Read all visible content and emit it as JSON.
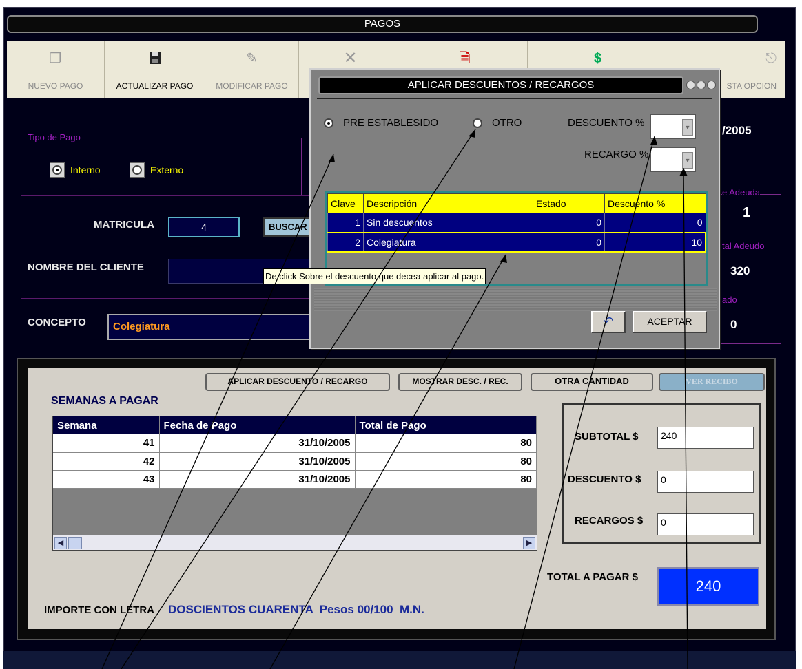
{
  "window": {
    "title": "PAGOS"
  },
  "toolbar": {
    "items": [
      {
        "label": "NUEVO PAGO",
        "icon": "new-page-icon",
        "glyph": "❐"
      },
      {
        "label": "ACTUALIZAR PAGO",
        "icon": "save-icon",
        "glyph": "💾"
      },
      {
        "label": "MODIFICAR PAGO",
        "icon": "edit-icon",
        "glyph": "✎"
      },
      {
        "label": "",
        "icon": "cancel-icon",
        "glyph": "✕"
      },
      {
        "label": "",
        "icon": "report-icon",
        "glyph": "🗎"
      },
      {
        "label": "",
        "icon": "money-icon",
        "glyph": "$"
      },
      {
        "label": "STA OPCION",
        "icon": "exit-door-icon",
        "glyph": "⎋"
      }
    ]
  },
  "tipo_pago": {
    "legend": "Tipo de Pago",
    "interno": "Interno",
    "externo": "Externo",
    "selected": "Interno"
  },
  "cliente": {
    "matricula_label": "MATRICULA",
    "matricula_value": "4",
    "buscar_label": "BUSCAR",
    "nombre_label": "NOMBRE DEL CLIENTE",
    "concepto_label": "CONCEPTO",
    "concepto_value": "Colegiatura"
  },
  "right_info": {
    "date_partial": "/2005",
    "adeuda_label": "e Adeuda",
    "adeuda_value": "1",
    "total_adeudo_label": "tal Adeudo",
    "total_adeudo_value": "320",
    "pagado_label": "ado",
    "pagado_value": "0"
  },
  "dialog": {
    "title": "APLICAR DESCUENTOS / RECARGOS",
    "option_pre": "PRE ESTABLESIDO",
    "option_otro": "OTRO",
    "descuento_label": "DESCUENTO %",
    "recargo_label": "RECARGO %",
    "columns": [
      "Clave",
      "Descripción",
      "Estado",
      "Descuento %"
    ],
    "rows": [
      [
        "1",
        "Sin descuentos",
        "0",
        "0"
      ],
      [
        "2",
        "Colegiatura",
        "0",
        "10"
      ]
    ],
    "tooltip": "De click Sobre el descuento que decea aplicar al pago.",
    "undo_glyph": "↶",
    "aceptar_label": "ACEPTAR"
  },
  "bottom": {
    "buttons": {
      "aplicar": "APLICAR   DESCUENTO / RECARGO",
      "mostrar": "MOSTRAR DESC. / REC.",
      "otra": "OTRA CANTIDAD",
      "recibo": "VER RECIBO"
    },
    "semanas_label": "SEMANAS A PAGAR",
    "columns": [
      "Semana",
      "Fecha de Pago",
      "Total de Pago"
    ],
    "rows": [
      [
        "41",
        "31/10/2005",
        "80"
      ],
      [
        "42",
        "31/10/2005",
        "80"
      ],
      [
        "43",
        "31/10/2005",
        "80"
      ]
    ],
    "subtotal_label": "SUBTOTAL  $",
    "subtotal_value": "240",
    "descuento_label": "DESCUENTO  $",
    "descuento_value": "0",
    "recargos_label": "RECARGOS  $",
    "recargos_value": "0",
    "total_label": "TOTAL A PAGAR $",
    "total_value": "240",
    "importe_label": "IMPORTE CON LETRA",
    "importe_value": "DOSCIENTOS CUARENTA  Pesos 00/100  M.N."
  }
}
